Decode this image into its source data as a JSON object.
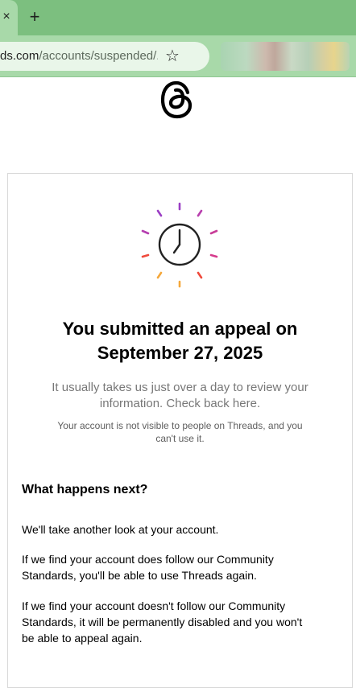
{
  "browser": {
    "tab_close_glyph": "×",
    "new_tab_glyph": "+",
    "url_host": "ds.com",
    "url_path": "/accounts/suspended/...",
    "bookmark_glyph": "☆"
  },
  "icons": {
    "logo": "threads-logo",
    "clock": "clock-icon"
  },
  "colors": {
    "tabstrip": "#7cbf7f",
    "toolbar": "#a8d9a9",
    "card_border": "#d9d9d9",
    "muted_text": "#777777",
    "sparkle_purple": "#9b3fc4",
    "sparkle_pink": "#d63b8c",
    "sparkle_red": "#ef4a3c",
    "sparkle_orange": "#f5a83c"
  },
  "appeal": {
    "title_line1": "You submitted an appeal on",
    "title_line2": "September 27, 2025",
    "lead_line1": "It usually takes us just over a day to review your",
    "lead_line2": "information. Check back here.",
    "note_line1": "Your account is not visible to people on Threads, and you",
    "note_line2": "can't use it."
  },
  "next": {
    "heading": "What happens next?",
    "p1": "We'll take another look at your account.",
    "p2_line1": "If we find your account does follow our Community",
    "p2_line2": "Standards, you'll be able to use Threads again.",
    "p3_line1": "If we find your account doesn't follow our Community",
    "p3_line2": "Standards, it will be permanently disabled and you won't",
    "p3_line3": "be able to appeal again."
  }
}
